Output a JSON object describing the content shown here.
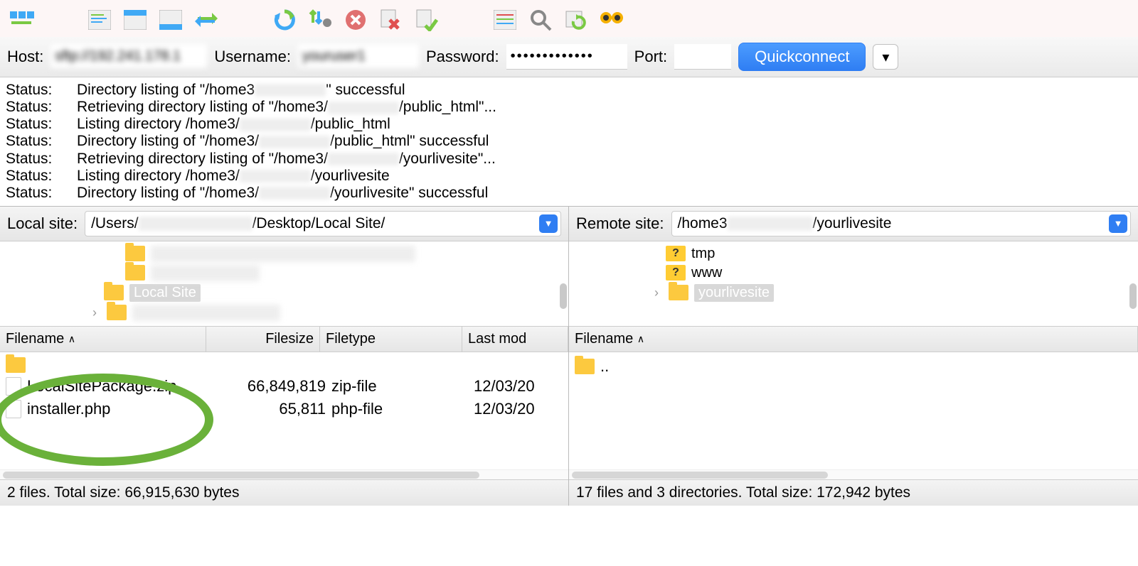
{
  "quickbar": {
    "host_label": "Host:",
    "host_value": "sftp://192.241.178.1",
    "user_label": "Username:",
    "user_value": "youruser1",
    "pass_label": "Password:",
    "pass_value": "•••••••••••••",
    "port_label": "Port:",
    "port_value": "",
    "connect_label": "Quickconnect"
  },
  "log": [
    {
      "label": "Status:",
      "prefix": "Directory listing of \"/home3",
      "suffix": "\" successful"
    },
    {
      "label": "Status:",
      "prefix": "Retrieving directory listing of \"/home3/",
      "suffix": "/public_html\"..."
    },
    {
      "label": "Status:",
      "prefix": "Listing directory /home3/",
      "suffix": "/public_html"
    },
    {
      "label": "Status:",
      "prefix": "Directory listing of \"/home3/",
      "suffix": "/public_html\" successful"
    },
    {
      "label": "Status:",
      "prefix": "Retrieving directory listing of \"/home3/",
      "suffix": "/yourlivesite\"..."
    },
    {
      "label": "Status:",
      "prefix": "Listing directory /home3/",
      "suffix": "/yourlivesite"
    },
    {
      "label": "Status:",
      "prefix": "Directory listing of \"/home3/",
      "suffix": "/yourlivesite\" successful"
    }
  ],
  "local": {
    "label": "Local site:",
    "path_prefix": "/Users/",
    "path_suffix": "/Desktop/Local Site/",
    "tree_selected": "Local Site",
    "columns": {
      "fn": "Filename",
      "fs": "Filesize",
      "ft": "Filetype",
      "lm": "Last mod"
    },
    "files": [
      {
        "name": "LocalSitePackage.zip",
        "size": "66,849,819",
        "type": "zip-file",
        "mod": "12/03/20"
      },
      {
        "name": "installer.php",
        "size": "65,811",
        "type": "php-file",
        "mod": "12/03/20"
      }
    ],
    "status": "2 files. Total size: 66,915,630 bytes"
  },
  "remote": {
    "label": "Remote site:",
    "path_prefix": "/home3",
    "path_suffix": "/yourlivesite",
    "tree": [
      {
        "name": "tmp",
        "q": true
      },
      {
        "name": "www",
        "q": true
      },
      {
        "name": "yourlivesite",
        "q": false,
        "selected": true
      }
    ],
    "columns": {
      "fn": "Filename"
    },
    "files": [
      {
        "name": ".."
      }
    ],
    "status": "17 files and 3 directories. Total size: 172,942 bytes"
  }
}
